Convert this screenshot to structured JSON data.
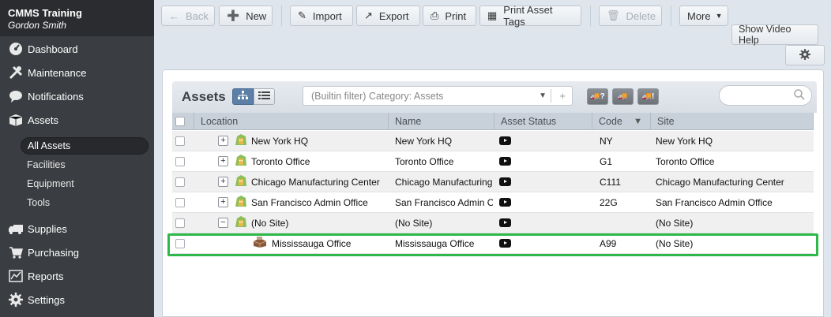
{
  "sidebar": {
    "app_name": "CMMS Training",
    "user_name": "Gordon Smith",
    "items": [
      {
        "label": "Dashboard",
        "icon": "dashboard-icon"
      },
      {
        "label": "Maintenance",
        "icon": "tools-icon"
      },
      {
        "label": "Notifications",
        "icon": "chat-bubble-icon"
      },
      {
        "label": "Assets",
        "icon": "box-icon"
      },
      {
        "label": "Supplies",
        "icon": "truck-icon"
      },
      {
        "label": "Purchasing",
        "icon": "cart-icon"
      },
      {
        "label": "Reports",
        "icon": "chart-icon"
      },
      {
        "label": "Settings",
        "icon": "gear-icon"
      }
    ],
    "sub_items": [
      {
        "label": "All Assets",
        "active": true
      },
      {
        "label": "Facilities"
      },
      {
        "label": "Equipment"
      },
      {
        "label": "Tools"
      }
    ]
  },
  "toolbar": {
    "back": "Back",
    "new": "New",
    "import": "Import",
    "export": "Export",
    "print": "Print",
    "print_tags": "Print Asset Tags",
    "delete": "Delete",
    "more": "More",
    "video_help": "Show Video Help"
  },
  "panel": {
    "title": "Assets",
    "filter_text": "(Builtin filter) Category: Assets",
    "truck_buttons": [
      "?",
      "",
      "!"
    ]
  },
  "table": {
    "columns": [
      "Location",
      "Name",
      "Asset Status",
      "Code",
      "Site"
    ],
    "rows": [
      {
        "location": "New York HQ",
        "tree": "+",
        "icon": "site-icon",
        "name": "New York HQ",
        "code": "NY",
        "site": "New York HQ"
      },
      {
        "location": "Toronto Office",
        "tree": "+",
        "icon": "site-icon",
        "name": "Toronto Office",
        "code": "G1",
        "site": "Toronto Office"
      },
      {
        "location": "Chicago Manufacturing Center",
        "tree": "+",
        "icon": "site-icon",
        "name": "Chicago Manufacturing...",
        "code": "C111",
        "site": "Chicago Manufacturing Center"
      },
      {
        "location": "San Francisco Admin Office",
        "tree": "+",
        "icon": "site-icon",
        "name": "San Francisco Admin O...",
        "code": "22G",
        "site": "San Francisco Admin Office"
      },
      {
        "location": "(No Site)",
        "tree": "−",
        "icon": "site-icon",
        "name": "(No Site)",
        "code": "",
        "site": "(No Site)"
      },
      {
        "location": "Mississauga Office",
        "tree": "",
        "icon": "building-icon",
        "name": "Mississauga Office",
        "code": "A99",
        "site": "(No Site)"
      }
    ]
  },
  "colors": {
    "highlight": "#2fb84a",
    "sidebar": "#3a3d41"
  }
}
